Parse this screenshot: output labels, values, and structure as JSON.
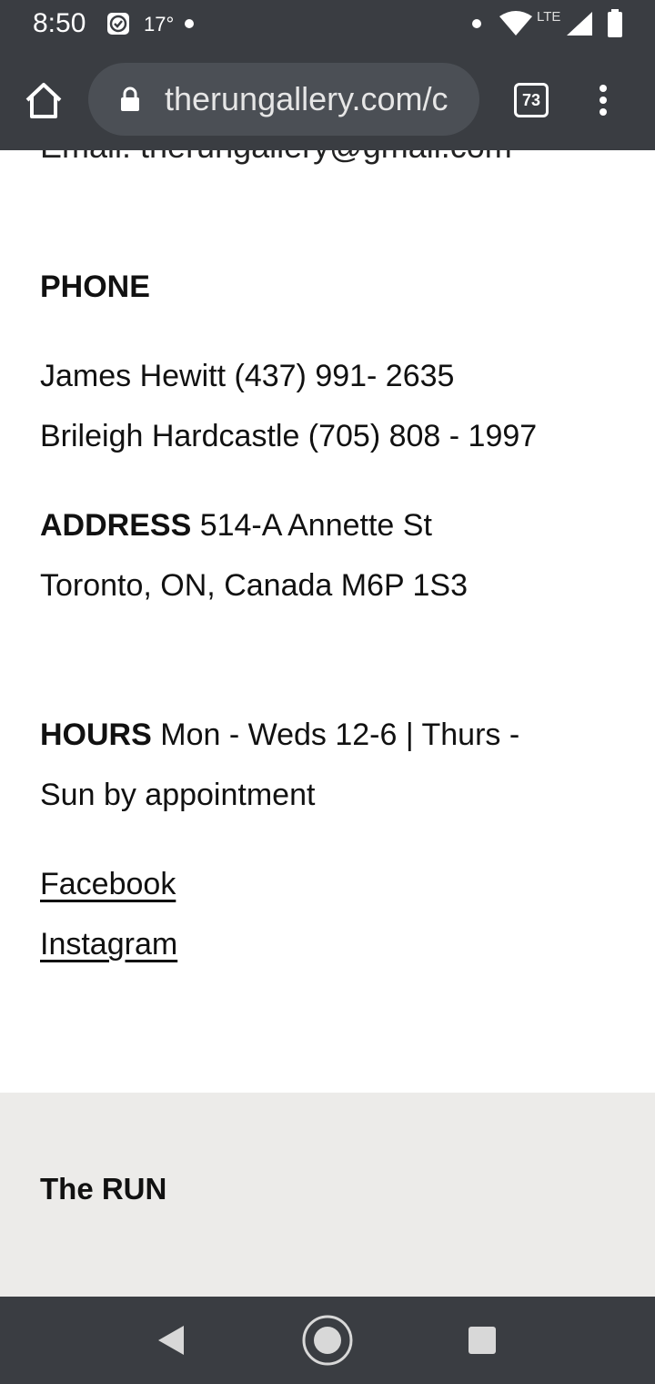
{
  "status_bar": {
    "time": "8:50",
    "temperature": "17°",
    "network": "LTE"
  },
  "browser": {
    "url": "therungallery.com/c",
    "tab_count": "73"
  },
  "contact": {
    "cut_off_line": "Email: therungallery@gmail.com",
    "phone_heading": "PHONE",
    "phone_lines": [
      "James Hewitt (437) 991- 2635",
      "Brileigh Hardcastle (705) 808 - 1997"
    ],
    "address_label": "ADDRESS",
    "address_line1": " 514-A Annette St",
    "address_line2": "Toronto, ON, Canada M6P 1S3",
    "hours_label": "HOURS",
    "hours_line1": " Mon - Weds 12-6 | Thurs -",
    "hours_line2": "Sun by appointment",
    "links": [
      "Facebook",
      "Instagram"
    ]
  },
  "footer": {
    "title": "The RUN"
  },
  "colors": {
    "system_bar": "#3a3d42",
    "url_pill": "#4b4f55",
    "footer_bg": "#ecebe9"
  },
  "icons": [
    "home-icon",
    "lock-icon",
    "tabs-icon",
    "more-vert-icon",
    "back-icon",
    "home-circle-icon",
    "recents-icon",
    "wifi-icon",
    "signal-icon",
    "battery-icon",
    "check-badge-icon"
  ]
}
